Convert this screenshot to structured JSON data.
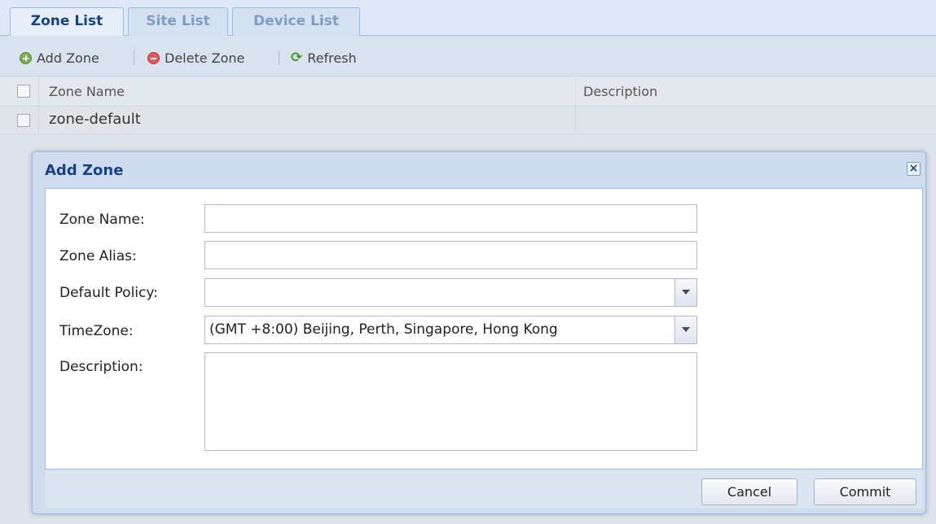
{
  "tabs": [
    {
      "label": "Zone List",
      "active": true
    },
    {
      "label": "Site List",
      "active": false
    },
    {
      "label": "Device List",
      "active": false
    }
  ],
  "toolbar": {
    "add_label": "Add Zone",
    "add_icon": "add-circle-icon",
    "delete_label": "Delete Zone",
    "delete_icon": "remove-circle-icon",
    "refresh_label": "Refresh",
    "refresh_icon": "refresh-icon"
  },
  "grid": {
    "columns": [
      "Zone Name",
      "Description"
    ],
    "rows": [
      {
        "zone_name": "zone-default",
        "description": ""
      }
    ]
  },
  "dialog": {
    "title": "Add Zone",
    "fields": {
      "zone_name": {
        "label": "Zone Name:",
        "value": ""
      },
      "zone_alias": {
        "label": "Zone Alias:",
        "value": ""
      },
      "default_policy": {
        "label": "Default Policy:",
        "value": ""
      },
      "timezone": {
        "label": "TimeZone:",
        "value": "(GMT +8:00) Beijing, Perth, Singapore, Hong Kong"
      },
      "description": {
        "label": "Description:",
        "value": ""
      }
    },
    "cancel_label": "Cancel",
    "commit_label": "Commit"
  },
  "colors": {
    "title_blue": "#15428b",
    "panel_border": "#99bbe8",
    "tab_bg": "#dfe8f6"
  }
}
